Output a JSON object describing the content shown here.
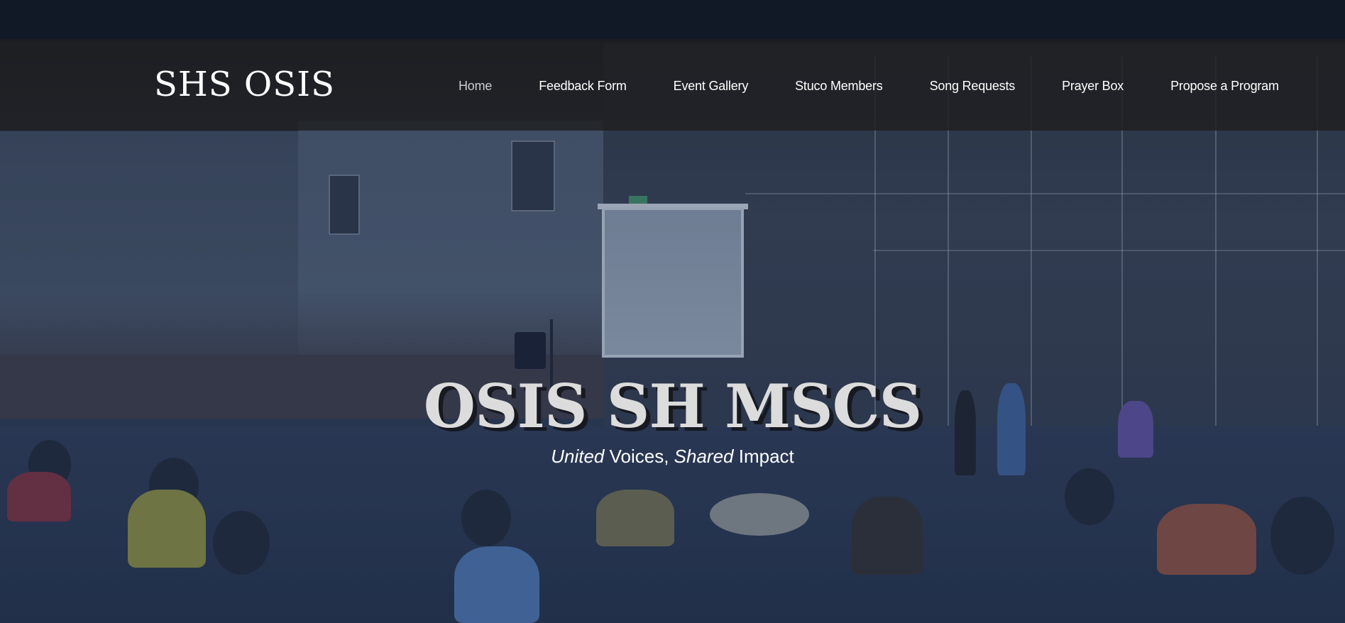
{
  "site": {
    "logo_text": "SHS OSIS"
  },
  "nav": {
    "items": [
      {
        "label": "Home",
        "active": true
      },
      {
        "label": "Feedback Form",
        "active": false
      },
      {
        "label": "Event Gallery",
        "active": false
      },
      {
        "label": "Stuco Members",
        "active": false
      },
      {
        "label": "Song Requests",
        "active": false
      },
      {
        "label": "Prayer Box",
        "active": false
      },
      {
        "label": "Propose a Program",
        "active": false
      }
    ]
  },
  "hero": {
    "title": "OSIS SH MSCS",
    "subtitle": {
      "part1_italic": "United",
      "part2": " Voices, ",
      "part3_italic": "Shared",
      "part4": " Impact"
    },
    "background_image": "school-assembly-hall-photo"
  },
  "colors": {
    "header_bg": "#1e1e20",
    "nav_text": "#ffffff",
    "nav_active_text": "#c9cdd3",
    "hero_title": "#dcdcdc",
    "overlay_tint": "#283c5f"
  }
}
